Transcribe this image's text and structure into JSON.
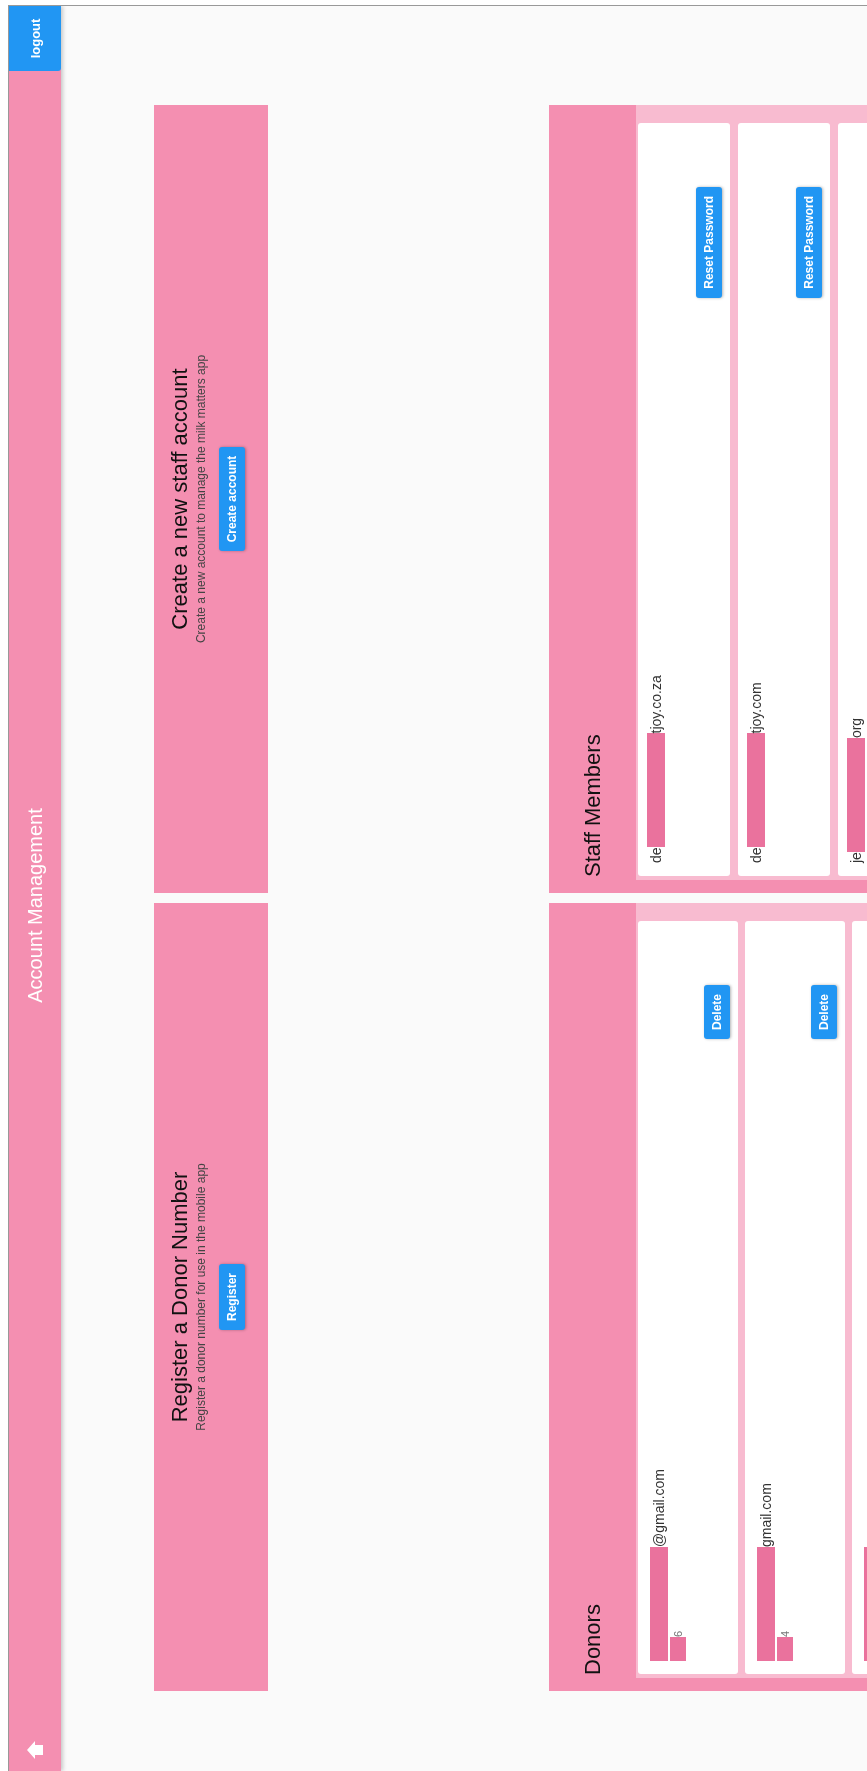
{
  "app_bar": {
    "title": "Account Management",
    "logout_button": "logout"
  },
  "action_cards": [
    {
      "title": "Register a Donor Number",
      "description": "Register a donor number for use in the mobile app",
      "button": "Register"
    },
    {
      "title": "Create a new staff account",
      "description": "Create a new account to manage the milk matters app",
      "button": "Create account"
    }
  ],
  "panels": [
    {
      "title": "Donors",
      "kind": "donors",
      "accounts": [
        {
          "redacted": true,
          "email_end": "@gmail.com",
          "number_end": "6",
          "button": "Delete"
        },
        {
          "redacted": true,
          "email_end": "gmail.com",
          "number_end": "4",
          "button": "Delete"
        },
        {
          "redacted": true
        }
      ]
    },
    {
      "title": "Staff Members",
      "kind": "staff",
      "accounts": [
        {
          "redacted": true,
          "email_start": "de",
          "email_end": "tjoy.co.za",
          "button": "Reset Password"
        },
        {
          "redacted": true,
          "email_start": "de",
          "email_end": "tjoy.com",
          "button": "Reset Password"
        },
        {
          "redacted": true,
          "email_start": "je",
          "email_end": "org"
        }
      ]
    }
  ]
}
